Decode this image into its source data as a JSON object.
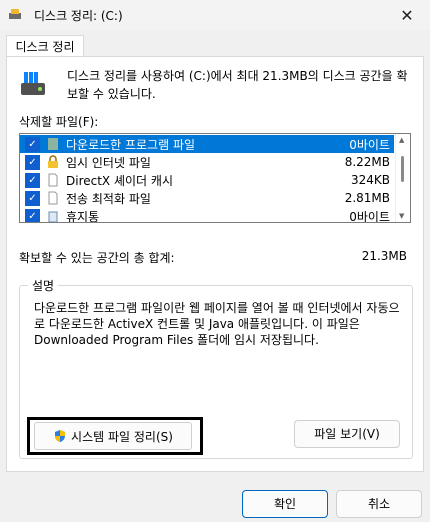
{
  "window": {
    "title": "디스크 정리: (C:)",
    "close_glyph": "✕"
  },
  "tab": {
    "label": "디스크 정리"
  },
  "intro": {
    "text": "디스크 정리를 사용하여 (C:)에서 최대 21.3MB의 디스크 공간을 확보할 수 있습니다."
  },
  "list": {
    "label": "삭제할 파일(F):",
    "items": [
      {
        "name": "다운로드한 프로그램 파일",
        "size": "0바이트",
        "checked": true,
        "selected": true,
        "icon": "folder-icon"
      },
      {
        "name": "임시 인터넷 파일",
        "size": "8.22MB",
        "checked": true,
        "selected": false,
        "icon": "lock-icon"
      },
      {
        "name": "DirectX 셰이더 캐시",
        "size": "324KB",
        "checked": true,
        "selected": false,
        "icon": "file-icon"
      },
      {
        "name": "전송 최적화 파일",
        "size": "2.81MB",
        "checked": true,
        "selected": false,
        "icon": "file-icon"
      },
      {
        "name": "휴지통",
        "size": "0바이트",
        "checked": true,
        "selected": false,
        "icon": "recycle-bin-icon"
      }
    ]
  },
  "total": {
    "label": "확보할 수 있는 공간의 총 합계:",
    "value": "21.3MB"
  },
  "description": {
    "label": "설명",
    "text": "다운로드한 프로그램 파일이란 웹 페이지를 열어 볼 때 인터넷에서 자동으로 다운로드한 ActiveX 컨트롤 및 Java 애플릿입니다. 이 파일은 Downloaded Program Files 폴더에 임시 저장됩니다."
  },
  "buttons": {
    "system_cleanup": "시스템 파일 정리(S)",
    "view_files": "파일 보기(V)",
    "ok": "확인",
    "cancel": "취소"
  },
  "colors": {
    "selection": "#0078d7",
    "checkbox": "#0f5fd1"
  }
}
